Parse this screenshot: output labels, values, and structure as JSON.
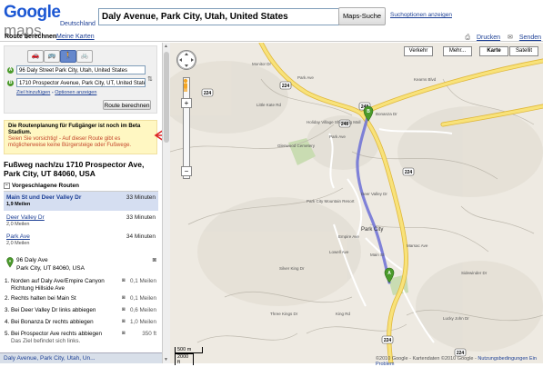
{
  "header": {
    "logo_word1": "Google",
    "logo_word2": "maps",
    "logo_country": "Deutschland",
    "search_value": "Daly Avenue, Park City, Utah, United States",
    "search_button": "Maps-Suche",
    "search_options": "Suchoptionen anzeigen"
  },
  "topbar": {
    "tab_route": "Route berechnen",
    "tab_mymaps": "Meine Karten",
    "print": "Drucken",
    "send": "Senden"
  },
  "route_form": {
    "start_label": "A",
    "start_value": "96 Daly Street Park City, Utah, United States",
    "end_label": "B",
    "end_value": "1710 Prospector Avenue, Park City, UT, United States",
    "add_destination": "Ziel hinzufügen",
    "separator": "-",
    "options": "Optionen anzeigen",
    "submit": "Route berechnen",
    "modes": [
      "car-icon",
      "transit-icon",
      "walk-icon",
      "bike-icon"
    ],
    "active_mode": 2
  },
  "warning": {
    "title": "Die Routenplanung für Fußgänger ist noch im Beta Stadium.",
    "text": "Seien Sie vorsichtig! - Auf dieser Route gibt es möglicherweise keine Bürgersteige oder Fußwege."
  },
  "route_title": "Fußweg nach/zu 1710 Prospector Ave, Park City, UT 84060, USA",
  "suggested_header": "Vorgeschlagene Routen",
  "routes": [
    {
      "name": "Main St und Deer Valley Dr",
      "duration": "33 Minuten",
      "distance": "1,9 Meilen"
    },
    {
      "name": "Deer Valley Dr",
      "duration": "33 Minuten",
      "distance": "2,0 Meilen"
    },
    {
      "name": "Park Ave",
      "duration": "34 Minuten",
      "distance": "2,0 Meilen"
    }
  ],
  "start_point": {
    "line1": "96 Daly Ave",
    "line2": "Park City, UT 84060, USA"
  },
  "steps": [
    {
      "n": "1.",
      "text": "Norden auf Daly Ave/Empire Canyon Richtung Hillside Ave",
      "dist": "0,1 Meilen"
    },
    {
      "n": "2.",
      "text": "Rechts halten bei Main St",
      "dist": "0,1 Meilen"
    },
    {
      "n": "3.",
      "text": "Bei Deer Valley Dr links abbiegen",
      "dist": "0,6 Meilen"
    },
    {
      "n": "4.",
      "text": "Bei Bonanza Dr rechts abbiegen",
      "dist": "1,0 Meilen"
    },
    {
      "n": "5.",
      "text": "Bei Prospector Ave rechts abbiegen",
      "sub": "Das Ziel befindet sich links.",
      "dist": "350 ft"
    }
  ],
  "bottom_left": "Daly Avenue, Park City, Utah, Un...",
  "map": {
    "buttons": [
      "Verkehr",
      "Mehr...",
      "Karte",
      "Satellit"
    ],
    "active_button": "Karte",
    "labels": {
      "kearns": "Kearns Blvd",
      "holiday": "Holiday Village Shopping Mall",
      "glenwood": "Glenwood Cemetery",
      "mountain_resort": "Park City Mountain Resort",
      "park_city": "Park City",
      "bonanza": "Bonanza Dr",
      "park_ave": "Park Ave",
      "deer_valley": "Deer Valley Dr",
      "king_rd": "King Rd",
      "marsac": "Marsac Ave",
      "lucky_john": "Lucky John Dr",
      "little_kate": "Little Kate Rd",
      "monitor": "Monitor Dr",
      "park_ave2": "Park Ave",
      "main": "Main St",
      "silver_king": "Silver King Dr",
      "lowell": "Lowell Ave",
      "three_kings": "Three Kings Dr",
      "empire": "Empire Ave",
      "sidewinder": "Sidewinder Dr"
    },
    "shields": [
      "224",
      "224",
      "248",
      "248",
      "224",
      "224",
      "224"
    ],
    "scale_1": "500 m",
    "scale_2": "2000 ft",
    "copyright": "©2010 Google - Kartendaten ©2010 Google -",
    "terms": "Nutzungsbedingungen",
    "problem": "Ein Problem"
  },
  "colors": {
    "route": "#6b6fd6",
    "highway": "#f7e06a",
    "warning_bg": "#fff7c2",
    "selected_route": "#d5def1"
  }
}
